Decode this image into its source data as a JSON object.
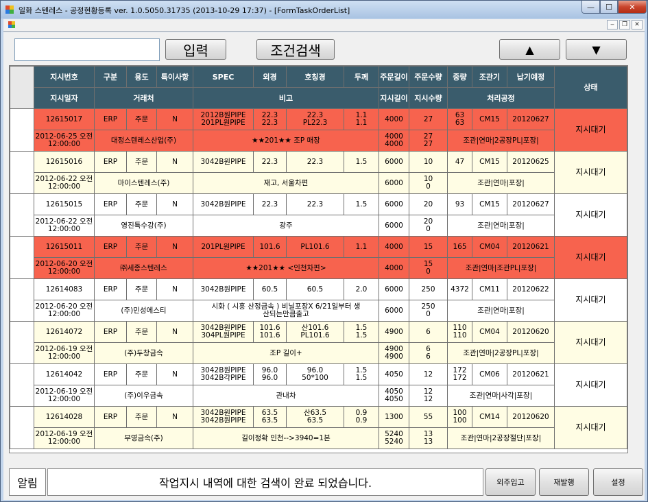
{
  "window": {
    "title": "일화 스텐레스 - 공정현황등록 ver. 1.0.5050.31735 (2013-10-29 17:37) - [FormTaskOrderList]",
    "min": "—",
    "max": "☐",
    "close": "✕"
  },
  "toolbar": {
    "search_value": "",
    "input_label": "입력",
    "search_label": "조건검색",
    "up_label": "▲",
    "down_label": "▼"
  },
  "grid": {
    "header1": [
      "지시번호",
      "구분",
      "용도",
      "특이사항",
      "SPEC",
      "외경",
      "호칭경",
      "두께",
      "주문길이",
      "주문수량",
      "중량",
      "조관기",
      "납기예정"
    ],
    "header_status": "상태",
    "header2": [
      "지시일자",
      "거래처",
      "비고",
      "지시길이",
      "지시수량",
      "처리공정"
    ],
    "rows": [
      {
        "color": "red",
        "order_no": "12615017",
        "type": "ERP",
        "usage": "주문",
        "special": "N",
        "spec": [
          "2012B원PIPE",
          "201PL원PIPE"
        ],
        "od": [
          "22.3",
          "22.3"
        ],
        "nominal": [
          "22.3",
          "PL22.3"
        ],
        "thickness": [
          "1.1",
          "1.1"
        ],
        "order_len": "4000",
        "order_qty": "27",
        "weight": [
          "63",
          "63"
        ],
        "mill": "CM15",
        "due": "20120627",
        "status": "지시대기",
        "date": [
          "2012-06-25 오전",
          "12:00:00"
        ],
        "client": "대정스텐레스산업(주)",
        "remark": "★★201★★ 조P 매장",
        "inst_len": [
          "4000",
          "4000"
        ],
        "inst_qty": [
          "27",
          "27"
        ],
        "process": "조관|연마|2공장PL|포장|"
      },
      {
        "color": "yellow",
        "order_no": "12615016",
        "type": "ERP",
        "usage": "주문",
        "special": "N",
        "spec": [
          "3042B원PIPE"
        ],
        "od": [
          "22.3"
        ],
        "nominal": [
          "22.3"
        ],
        "thickness": [
          "1.5"
        ],
        "order_len": "6000",
        "order_qty": "10",
        "weight": [
          "47"
        ],
        "mill": "CM15",
        "due": "20120625",
        "status": "지시대기",
        "date": [
          "2012-06-22 오전",
          "12:00:00"
        ],
        "client": "마이스텐레스(주)",
        "remark": "재고, 서울차편",
        "inst_len": [
          "6000"
        ],
        "inst_qty": [
          "10",
          "0"
        ],
        "process": "조관|연마|포장|"
      },
      {
        "color": "white",
        "order_no": "12615015",
        "type": "ERP",
        "usage": "주문",
        "special": "N",
        "spec": [
          "3042B원PIPE"
        ],
        "od": [
          "22.3"
        ],
        "nominal": [
          "22.3"
        ],
        "thickness": [
          "1.5"
        ],
        "order_len": "6000",
        "order_qty": "20",
        "weight": [
          "93"
        ],
        "mill": "CM15",
        "due": "20120627",
        "status": "지시대기",
        "date": [
          "2012-06-22 오전",
          "12:00:00"
        ],
        "client": "영진특수강(주)",
        "remark": "광주",
        "inst_len": [
          "6000"
        ],
        "inst_qty": [
          "20",
          "0"
        ],
        "process": "조관|연마|포장|"
      },
      {
        "color": "red",
        "order_no": "12615011",
        "type": "ERP",
        "usage": "주문",
        "special": "N",
        "spec": [
          "201PL원PIPE"
        ],
        "od": [
          "101.6"
        ],
        "nominal": [
          "PL101.6"
        ],
        "thickness": [
          "1.1"
        ],
        "order_len": "4000",
        "order_qty": "15",
        "weight": [
          "165"
        ],
        "mill": "CM04",
        "due": "20120621",
        "status": "지시대기",
        "date": [
          "2012-06-20 오전",
          "12:00:00"
        ],
        "client": "㈜세종스텐레스",
        "remark": "★★201★★ <인천차편>",
        "inst_len": [
          "4000"
        ],
        "inst_qty": [
          "15",
          "0"
        ],
        "process": "조관|연마|조관PL|포장|"
      },
      {
        "color": "white",
        "order_no": "12614083",
        "type": "ERP",
        "usage": "주문",
        "special": "N",
        "spec": [
          "3042B원PIPE"
        ],
        "od": [
          "60.5"
        ],
        "nominal": [
          "60.5"
        ],
        "thickness": [
          "2.0"
        ],
        "order_len": "6000",
        "order_qty": "250",
        "weight": [
          "4372"
        ],
        "mill": "CM11",
        "due": "20120622",
        "status": "지시대기",
        "date": [
          "2012-06-20 오전",
          "12:00:00"
        ],
        "client": "(주)민성에스티",
        "remark": [
          "시화 ( 시흥 산정금속 )   비닐포장X    6/21일부터 생",
          "산되는만큼출고"
        ],
        "inst_len": [
          "6000"
        ],
        "inst_qty": [
          "250",
          "0"
        ],
        "process": "조관|연마|포장|"
      },
      {
        "color": "yellow",
        "order_no": "12614072",
        "type": "ERP",
        "usage": "주문",
        "special": "N",
        "spec": [
          "3042B원PIPE",
          "304PL원PIPE"
        ],
        "od": [
          "101.6",
          "101.6"
        ],
        "nominal": [
          "산101.6",
          "PL101.6"
        ],
        "thickness": [
          "1.5",
          "1.5"
        ],
        "order_len": "4900",
        "order_qty": "6",
        "weight": [
          "110",
          "110"
        ],
        "mill": "CM04",
        "due": "20120620",
        "status": "지시대기",
        "date": [
          "2012-06-19 오전",
          "12:00:00"
        ],
        "client": "(주)두창금속",
        "remark": "조P 길이+",
        "inst_len": [
          "4900",
          "4900"
        ],
        "inst_qty": [
          "6",
          "6"
        ],
        "process": "조관|연마|2공장PL|포장|"
      },
      {
        "color": "white",
        "order_no": "12614042",
        "type": "ERP",
        "usage": "주문",
        "special": "N",
        "spec": [
          "3042B원PIPE",
          "3042B각PIPE"
        ],
        "od": [
          "96.0",
          "96.0"
        ],
        "nominal": [
          "96.0",
          "50*100"
        ],
        "thickness": [
          "1.5",
          "1.5"
        ],
        "order_len": "4050",
        "order_qty": "12",
        "weight": [
          "172",
          "172"
        ],
        "mill": "CM06",
        "due": "20120621",
        "status": "지시대기",
        "date": [
          "2012-06-19 오전",
          "12:00:00"
        ],
        "client": "(주)이우금속",
        "remark": "관내차",
        "inst_len": [
          "4050",
          "4050"
        ],
        "inst_qty": [
          "12",
          "12"
        ],
        "process": "조관|연마|사각|포장|"
      },
      {
        "color": "yellow",
        "order_no": "12614028",
        "type": "ERP",
        "usage": "주문",
        "special": "N",
        "spec": [
          "3042B원PIPE",
          "3042B원PIPE"
        ],
        "od": [
          "63.5",
          "63.5"
        ],
        "nominal": [
          "산63.5",
          "63.5"
        ],
        "thickness": [
          "0.9",
          "0.9"
        ],
        "order_len": "1300",
        "order_qty": "55",
        "weight": [
          "100",
          "100"
        ],
        "mill": "CM14",
        "due": "20120620",
        "status": "지시대기",
        "date": [
          "2012-06-19 오전",
          "12:00:00"
        ],
        "client": "부영금속(주)",
        "remark": "길이정확 인천-->3940=1본",
        "inst_len": [
          "5240",
          "5240"
        ],
        "inst_qty": [
          "13",
          "13"
        ],
        "process": "조관|연마|2공장절단|포장|"
      }
    ]
  },
  "bottom": {
    "notice_label": "알림",
    "notice": "작업지시 내역에 대한 검색이 완료 되었습니다.",
    "outsource_label": "외주입고",
    "reissue_label": "재발행",
    "settings_label": "설정"
  },
  "colors": {
    "red_row": "#f7634e",
    "yellow_row": "#fffde4",
    "header": "#3a5c6c"
  }
}
